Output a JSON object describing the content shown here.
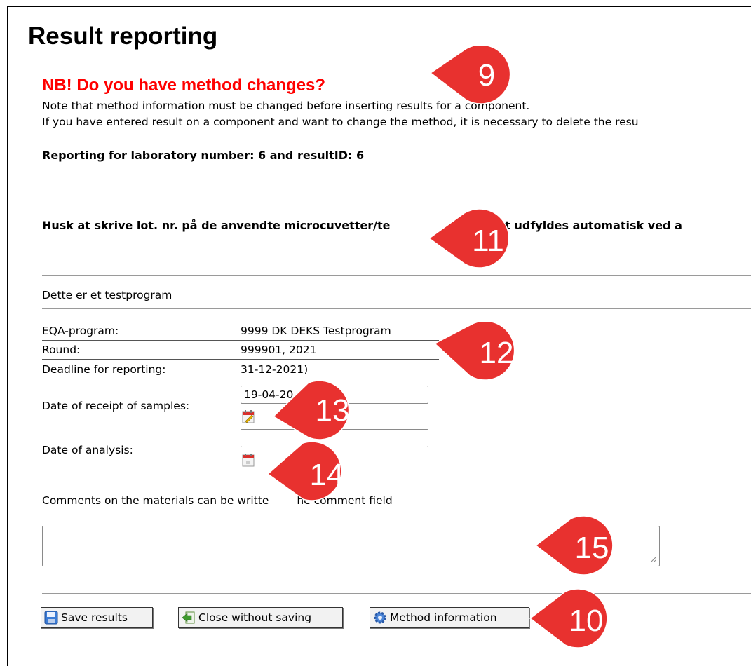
{
  "page": {
    "title": "Result reporting",
    "warning_title": "NB! Do you have method changes?",
    "note_line1": "Note that method information must be changed before inserting results for a component.",
    "note_line2": "If you have entered result on a component and want to change the method, it is necessary to delete the resu",
    "reporting_line": "Reporting for laboratory number: 6  and resultID:  6",
    "reminder": "Husk at skrive lot. nr. på de anvendte microcuvetter/te",
    "reminder_tail": ". Det udfyldes automatisk ved a",
    "test_program_note": "Dette er et testprogram"
  },
  "info": {
    "eqa_label": "EQA-program:",
    "eqa_value": "9999  DK  DEKS Testprogram",
    "round_label": "Round:",
    "round_value": "999901, 2021",
    "deadline_label": "Deadline for reporting:",
    "deadline_value": "31-12-2021)"
  },
  "form": {
    "receipt_label": "Date of receipt of samples:",
    "receipt_value": "19-04-20",
    "analysis_label": "Date of analysis:",
    "analysis_value": "",
    "comments_label_start": "Comments on the materials can be writte",
    "comments_label_end": "he comment field",
    "comments_value": ""
  },
  "buttons": {
    "save": "Save results",
    "close": "Close without saving",
    "method": "Method information"
  },
  "markers": [
    "9",
    "11",
    "12",
    "13",
    "14",
    "15",
    "10"
  ],
  "colors": {
    "warning": "#ff0000",
    "marker": "#e8312f"
  }
}
